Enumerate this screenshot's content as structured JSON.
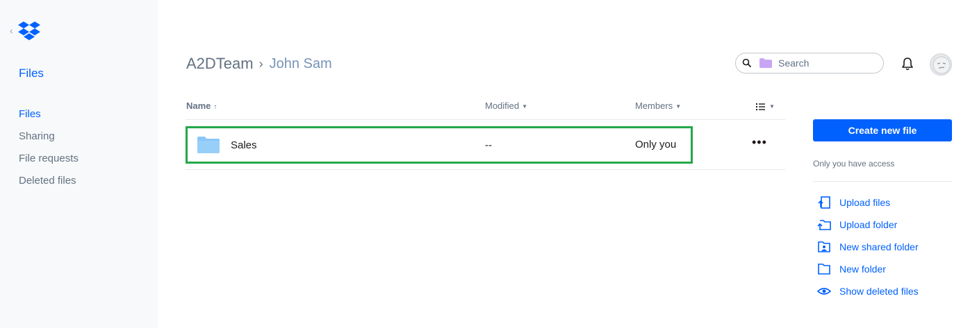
{
  "colors": {
    "accent": "#0061fe",
    "highlight": "#23a84a",
    "sidebar_bg": "#f7f9fa",
    "folder": "#8ac6f7"
  },
  "sidebar": {
    "logo_icon": "dropbox-logo-icon",
    "title": "Files",
    "items": [
      {
        "label": "Files",
        "active": true
      },
      {
        "label": "Sharing",
        "active": false
      },
      {
        "label": "File requests",
        "active": false
      },
      {
        "label": "Deleted files",
        "active": false
      }
    ]
  },
  "breadcrumb": {
    "root": "A2DTeam",
    "current": "John Sam"
  },
  "search": {
    "placeholder": "Search"
  },
  "table": {
    "columns": {
      "name": "Name",
      "modified": "Modified",
      "members": "Members"
    },
    "rows": [
      {
        "name": "Sales",
        "modified": "--",
        "members": "Only you",
        "more": "•••"
      }
    ]
  },
  "right_panel": {
    "create_label": "Create new file",
    "access_text": "Only you have access",
    "actions": [
      {
        "label": "Upload files",
        "icon": "upload-files-icon"
      },
      {
        "label": "Upload folder",
        "icon": "upload-folder-icon"
      },
      {
        "label": "New shared folder",
        "icon": "shared-folder-icon"
      },
      {
        "label": "New folder",
        "icon": "new-folder-icon"
      },
      {
        "label": "Show deleted files",
        "icon": "eye-icon"
      }
    ]
  }
}
